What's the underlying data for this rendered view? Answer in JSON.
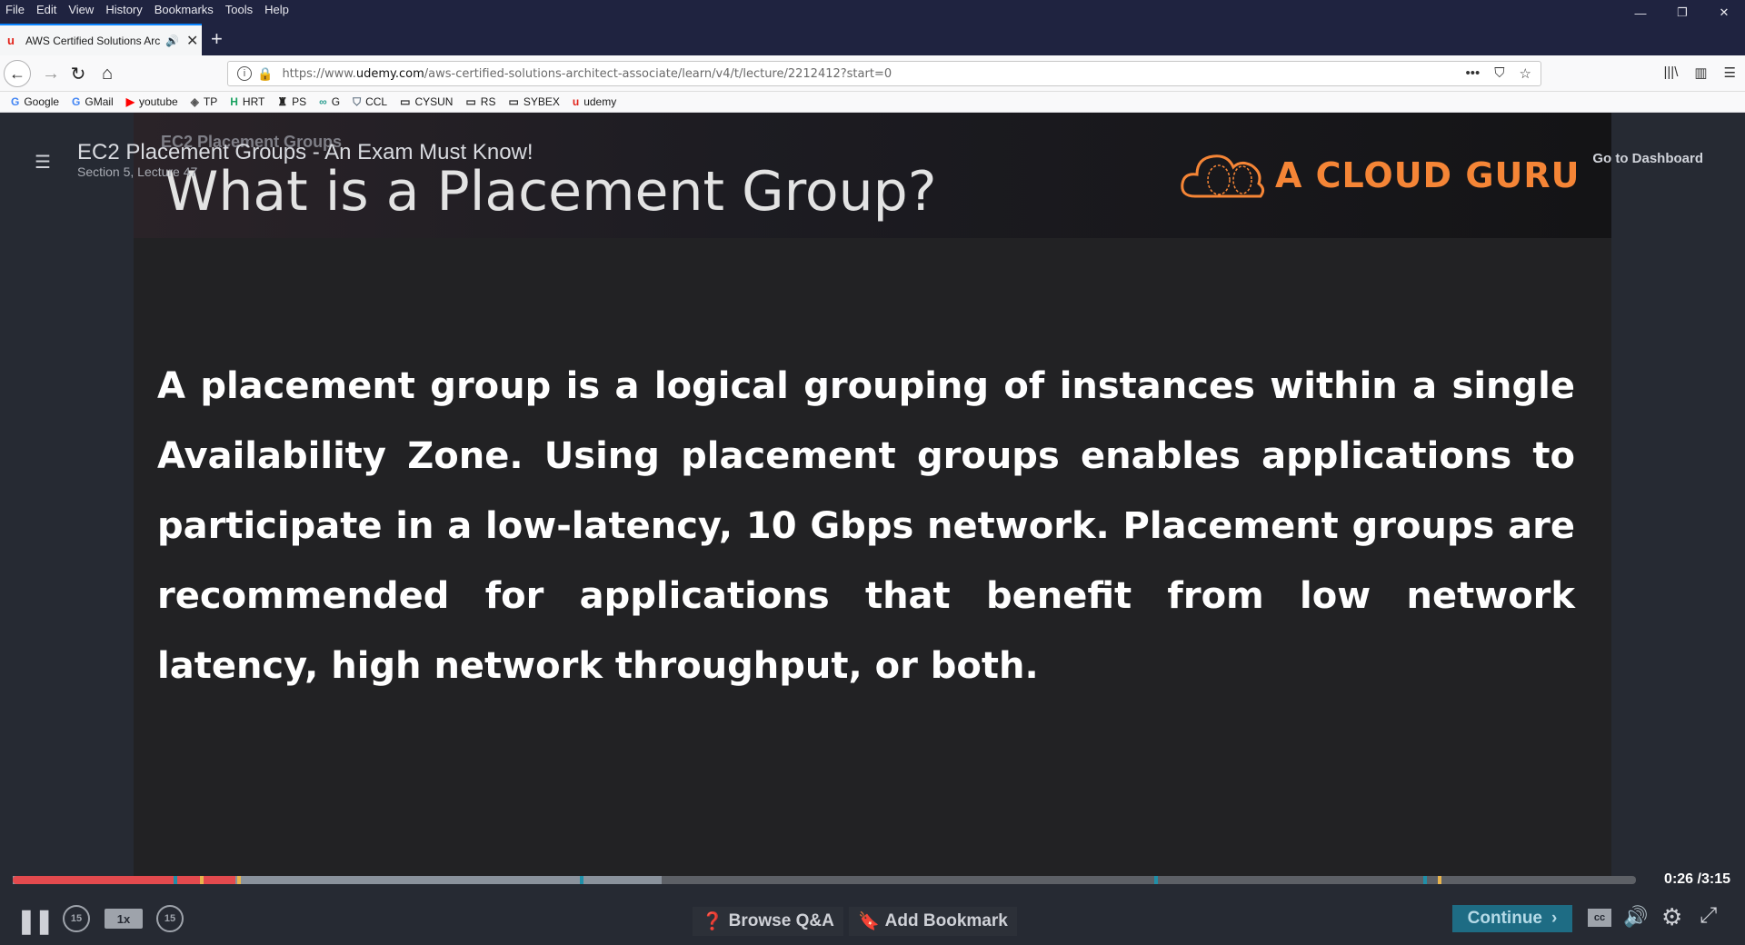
{
  "menu": [
    "File",
    "Edit",
    "View",
    "History",
    "Bookmarks",
    "Tools",
    "Help"
  ],
  "window": {
    "minimize": "—",
    "restore": "❐",
    "close": "✕"
  },
  "tab": {
    "title": "AWS Certified Solutions Arc",
    "favicon": "udemy-icon",
    "close": "✕",
    "new_tab": "+"
  },
  "nav": {
    "url_prefix": "https://www.",
    "url_domain": "udemy.com",
    "url_path": "/aws-certified-solutions-architect-associate/learn/v4/t/lecture/2212412?start=0"
  },
  "bookmarks": [
    {
      "icon": "G",
      "label": "Google",
      "color": "#4285f4"
    },
    {
      "icon": "G",
      "label": "GMail",
      "color": "#4285f4"
    },
    {
      "icon": "▶",
      "label": "youtube",
      "color": "#ff0000"
    },
    {
      "icon": "◈",
      "label": "TP",
      "color": "#555555"
    },
    {
      "icon": "H",
      "label": "HRT",
      "color": "#1aa260"
    },
    {
      "icon": "♜",
      "label": "PS",
      "color": "#222222"
    },
    {
      "icon": "∞",
      "label": "G",
      "color": "#2a9d8f"
    },
    {
      "icon": "⛉",
      "label": "CCL",
      "color": "#607080"
    },
    {
      "icon": "▭",
      "label": "CYSUN",
      "color": "#333333"
    },
    {
      "icon": "▭",
      "label": "RS",
      "color": "#333333"
    },
    {
      "icon": "▭",
      "label": "SYBEX",
      "color": "#333333"
    },
    {
      "icon": "u",
      "label": "udemy",
      "color": "#e2231a"
    }
  ],
  "player": {
    "lecture_title": "EC2 Placement Groups - An Exam Must Know!",
    "lecture_sub": "Section 5, Lecture 47",
    "dashboard": "Go to Dashboard",
    "time_current": "0:26",
    "time_total": "/3:15",
    "rate": "1x",
    "skip_seconds": "15",
    "browse_qa": "Browse Q&A",
    "add_bookmark": "Add Bookmark",
    "continue": "Continue",
    "cc_label": "cc",
    "progress_played": 0.137,
    "progress_buffered": 0.4,
    "accent": "#e34a4e"
  },
  "slide": {
    "small_title": "EC2 Placement Groups",
    "title": "What is a Placement Group?",
    "logo_text": "A CLOUD GURU",
    "body": "A placement group is a logical grouping of instances within a single Availability Zone. Using placement groups enables applications to participate in a low-latency, 10 Gbps network. Placement groups are recommended for applications that benefit from low network latency, high network throughput, or both."
  }
}
